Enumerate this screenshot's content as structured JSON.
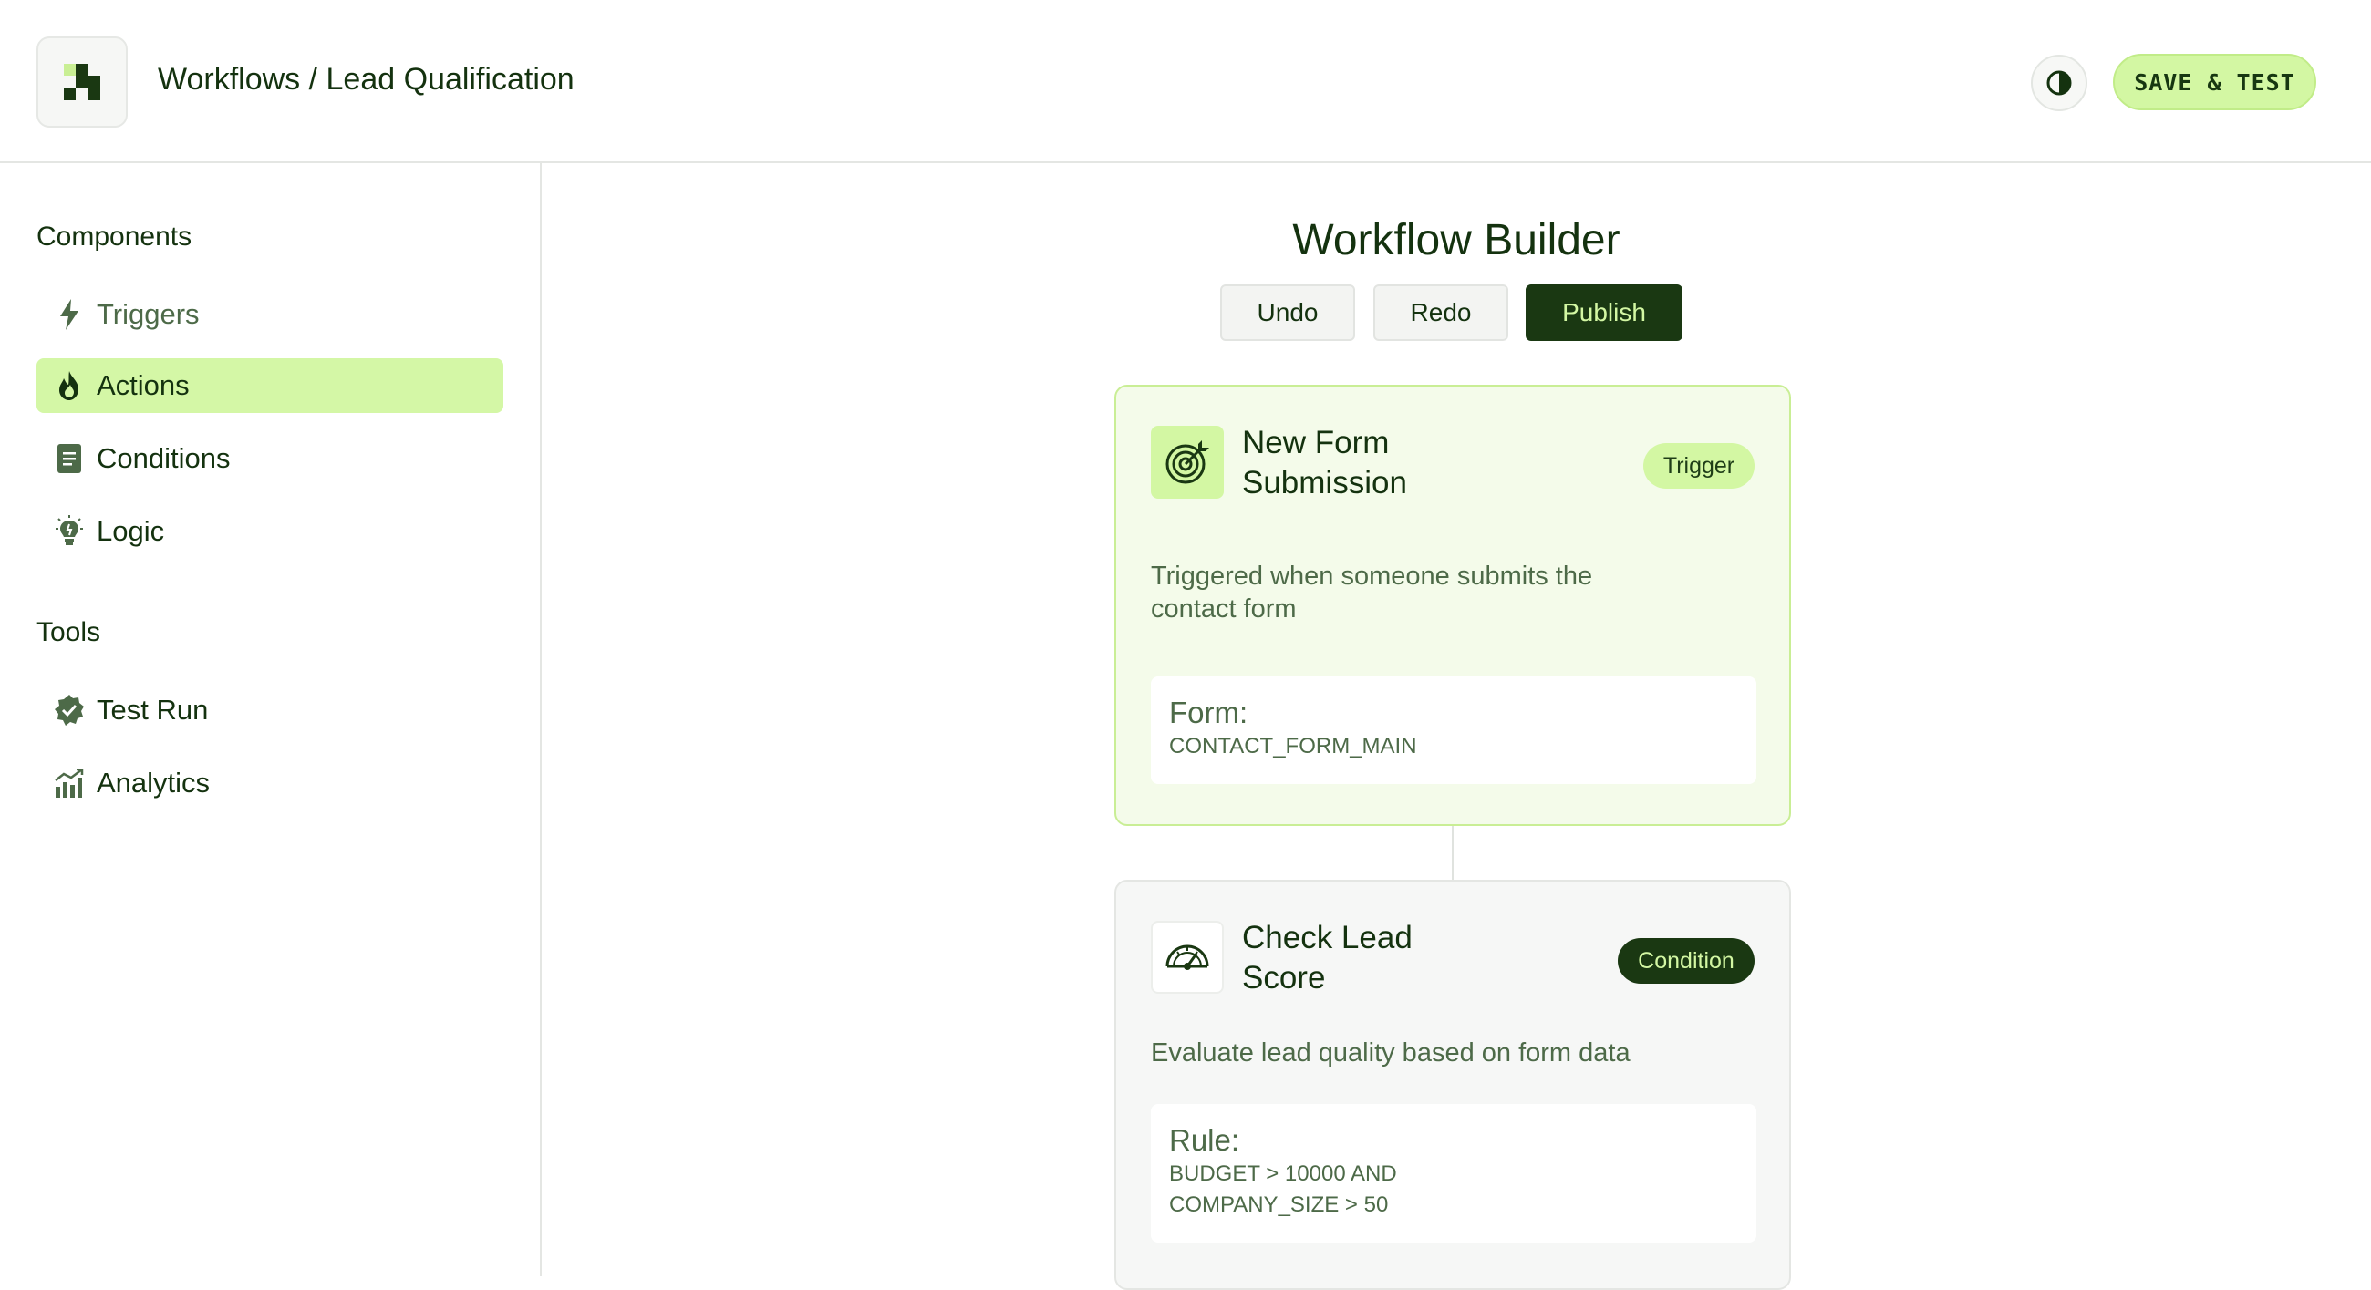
{
  "header": {
    "breadcrumb": "Workflows / Lead Qualification",
    "save_label": "SAVE & TEST"
  },
  "sidebar": {
    "components_title": "Components",
    "components": [
      {
        "label": "Triggers",
        "icon": "lightning-icon",
        "state": "muted"
      },
      {
        "label": "Actions",
        "icon": "flame-icon",
        "state": "active"
      },
      {
        "label": "Conditions",
        "icon": "document-icon",
        "state": "normal"
      },
      {
        "label": "Logic",
        "icon": "lightbulb-icon",
        "state": "normal"
      }
    ],
    "tools_title": "Tools",
    "tools": [
      {
        "label": "Test Run",
        "icon": "verified-badge-icon"
      },
      {
        "label": "Analytics",
        "icon": "bar-chart-icon"
      }
    ]
  },
  "main": {
    "title": "Workflow Builder",
    "undo_label": "Undo",
    "redo_label": "Redo",
    "publish_label": "Publish",
    "cards": [
      {
        "title": "New Form Submission",
        "badge": "Trigger",
        "description": "Triggered when someone submits the contact form",
        "detail_label": "Form:",
        "detail_value": "CONTACT_FORM_MAIN",
        "icon": "target-icon"
      },
      {
        "title": "Check Lead Score",
        "badge": "Condition",
        "description": "Evaluate lead quality based on form data",
        "detail_label": "Rule:",
        "detail_value": "BUDGET > 10000 AND COMPANY_SIZE > 50",
        "icon": "gauge-icon"
      }
    ]
  },
  "colors": {
    "accent": "#d3f7a3",
    "dark": "#1a3812",
    "text": "#14320f",
    "muted_text": "#4d6a48"
  }
}
